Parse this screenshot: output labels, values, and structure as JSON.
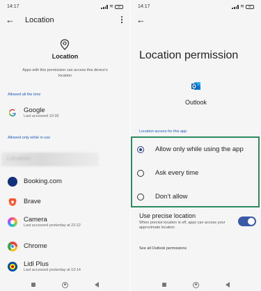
{
  "status": {
    "time": "14:17",
    "battery": "55"
  },
  "left": {
    "title": "Location",
    "heading": "Location",
    "description": "Apps with this permission can access this device's location",
    "section_all_time": "Allowed all the time",
    "section_in_use": "Allowed only while in use",
    "blurred_text": "Location",
    "apps_all_time": [
      {
        "name": "Google",
        "sub": "Last accessed 10:39"
      }
    ],
    "apps_in_use": [
      {
        "name": "Booking.com",
        "sub": ""
      },
      {
        "name": "Brave",
        "sub": ""
      },
      {
        "name": "Camera",
        "sub": "Last accessed yesterday at 22:22"
      },
      {
        "name": "Chrome",
        "sub": ""
      },
      {
        "name": "Lidl Plus",
        "sub": "Last accessed yesterday at 10:14"
      }
    ]
  },
  "right": {
    "title": "Location permission",
    "app_name": "Outlook",
    "access_label": "Location access for this app",
    "options": [
      {
        "label": "Allow only while using the app",
        "selected": true
      },
      {
        "label": "Ask every time",
        "selected": false
      },
      {
        "label": "Don’t allow",
        "selected": false
      }
    ],
    "precise_title": "Use precise location",
    "precise_sub": "When precise location is off, apps can access your approximate location",
    "precise_on": true,
    "see_all": "See all Outlook permissions"
  },
  "icons": {
    "google": "google-logo",
    "booking": "booking-logo",
    "brave": "brave-logo",
    "camera": "camera-logo",
    "chrome": "chrome-logo",
    "lidl": "lidl-logo",
    "outlook": "outlook-logo"
  },
  "colors": {
    "accent": "#1a5cc4",
    "highlight_border": "#2c8a5e",
    "toggle": "#3a5aa8"
  }
}
